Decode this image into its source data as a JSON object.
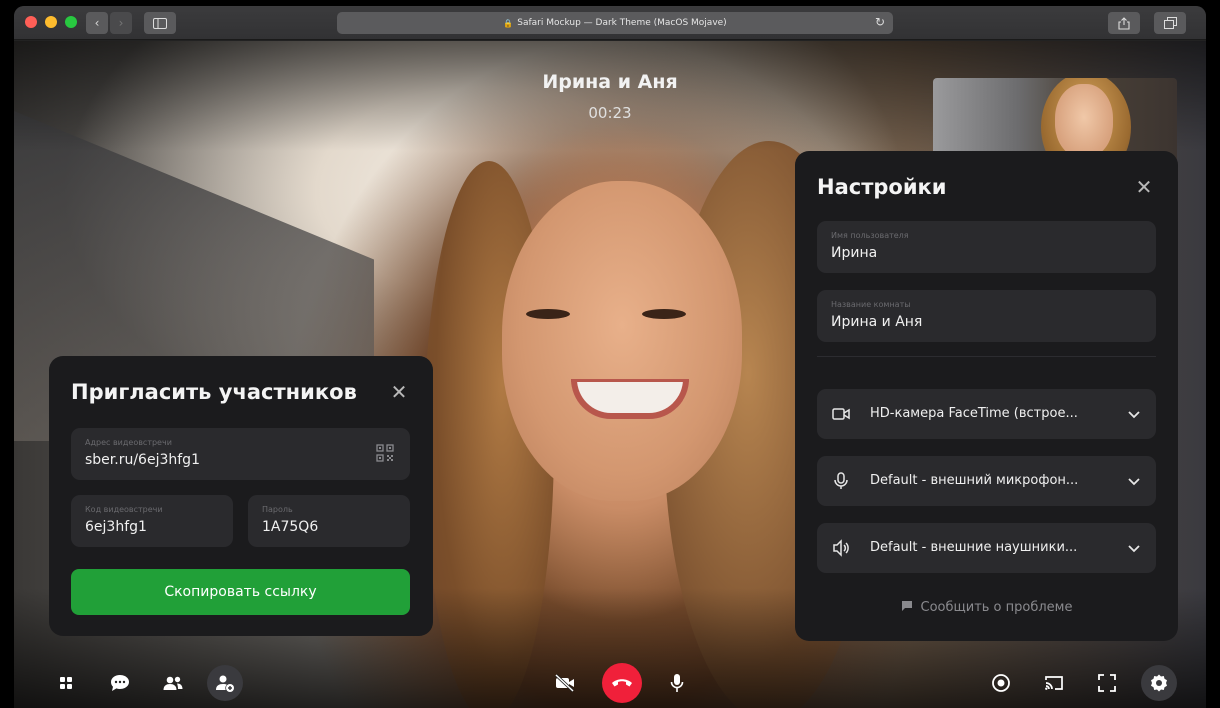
{
  "browser": {
    "address": "Safari Mockup — Dark Theme (MacOS Mojave)"
  },
  "call": {
    "title": "Ирина и Аня",
    "timer": "00:23"
  },
  "invite": {
    "title": "Пригласить участников",
    "meeting_address_label": "Адрес видеовстречи",
    "meeting_address_value": "sber.ru/6ej3hfg1",
    "meeting_code_label": "Код видеовстречи",
    "meeting_code_value": "6ej3hfg1",
    "password_label": "Пароль",
    "password_value": "1A75Q6",
    "copy_button": "Скопировать ссылку"
  },
  "settings": {
    "title": "Настройки",
    "username_label": "Имя пользователя",
    "username_value": "Ирина",
    "room_label": "Название комнаты",
    "room_value": "Ирина и Аня",
    "camera": "HD-камера FaceTime (встрое...",
    "microphone": "Default - внешний микрофон...",
    "speakers": "Default - внешние наушники...",
    "report_problem": "Сообщить о проблеме"
  },
  "controls": {
    "left": [
      "apps-icon",
      "chat-icon",
      "participants-icon",
      "add-participant-icon"
    ],
    "center": [
      "camera-off-icon",
      "hangup-icon",
      "microphone-icon"
    ],
    "right": [
      "record-icon",
      "cast-icon",
      "fullscreen-icon",
      "settings-gear-icon"
    ]
  },
  "colors": {
    "accent_green": "#21a038",
    "hangup_red": "#f0203a",
    "panel_bg": "#1b1b1d",
    "field_bg": "#2a2a2d"
  }
}
